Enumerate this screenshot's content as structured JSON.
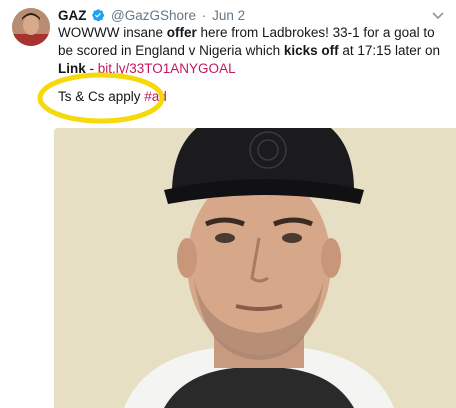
{
  "tweet": {
    "author_name": "GAZ",
    "handle": "@GazGShore",
    "separator": "·",
    "date": "Jun 2",
    "text_part1": "WOWWW insane ",
    "text_bold1": "offer",
    "text_part2": " here from Ladbrokes! 33-1 for a goal to be scored in England v Nigeria which ",
    "text_bold2": "kicks off",
    "text_part3": " at 17:15 later on",
    "link_label": "Link",
    "link_sep": " - ",
    "link_url": "bit.ly/33TO1ANYGOAL",
    "tcs_text": "Ts & Cs apply ",
    "hashtag": "#ad"
  },
  "icons": {
    "verified": "verified-badge-icon",
    "caret": "chevron-down-icon"
  },
  "colors": {
    "link": "#c2185b",
    "verified": "#1da1f2",
    "highlight": "#f5d90a",
    "muted": "#657786"
  }
}
